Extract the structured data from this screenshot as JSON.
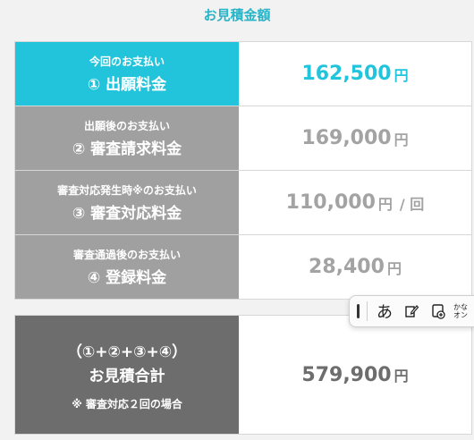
{
  "title": "お見積金額",
  "rows": [
    {
      "sub": "今回のお支払い",
      "main": "① 出願料金",
      "amount": "162,500",
      "unit": "円",
      "suffix": ""
    },
    {
      "sub": "出願後のお支払い",
      "main": "② 審査請求料金",
      "amount": "169,000",
      "unit": "円",
      "suffix": ""
    },
    {
      "sub": "審査対応発生時※のお支払い",
      "main": "③ 審査対応料金",
      "amount": "110,000",
      "unit": "円",
      "suffix": "/ 回"
    },
    {
      "sub": "審査通過後のお支払い",
      "main": "④ 登録料金",
      "amount": "28,400",
      "unit": "円",
      "suffix": ""
    }
  ],
  "total": {
    "formula": "（①+②+③+④）",
    "label": "お見積合計",
    "note": "※ 審査対応２回の場合",
    "amount": "579,900",
    "unit": "円"
  },
  "ime_toolbar": {
    "hiragana": "あ",
    "kana_label_1": "かな",
    "kana_label_2": "オン"
  },
  "colors": {
    "accent": "#22c4dc",
    "gray_label": "#a0a0a0",
    "dark_label": "#6d6d6d"
  }
}
